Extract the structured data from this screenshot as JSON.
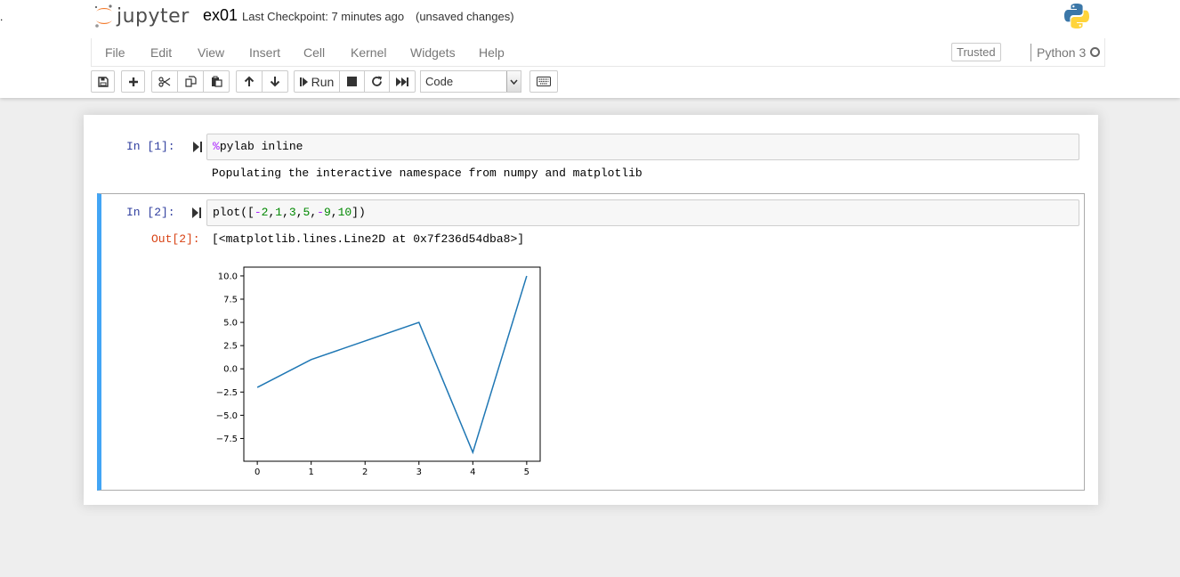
{
  "header": {
    "logo_text": "jupyter",
    "notebook_name": "ex01",
    "checkpoint": "Last Checkpoint: 7 minutes ago",
    "autosave": "(unsaved changes)"
  },
  "menubar": {
    "items": [
      "File",
      "Edit",
      "View",
      "Insert",
      "Cell",
      "Kernel",
      "Widgets",
      "Help"
    ],
    "trusted": "Trusted",
    "kernel": "Python 3"
  },
  "toolbar": {
    "run_label": "Run",
    "cell_type": "Code",
    "icons": [
      "save-icon",
      "plus-icon",
      "cut-icon",
      "copy-icon",
      "paste-icon",
      "arrow-up-icon",
      "arrow-down-icon",
      "step-forward-icon",
      "stop-icon",
      "refresh-icon",
      "fast-forward-icon",
      "keyboard-icon"
    ]
  },
  "cells": [
    {
      "prompt": "In [1]:",
      "code_parts": [
        {
          "text": "%",
          "cls": "cm-magic"
        },
        {
          "text": "pylab inline",
          "cls": ""
        }
      ],
      "output": "Populating the interactive namespace from numpy and matplotlib"
    },
    {
      "prompt": "In [2]:",
      "code_parts": [
        {
          "text": "plot([",
          "cls": ""
        },
        {
          "text": "-",
          "cls": "cm-op"
        },
        {
          "text": "2",
          "cls": "cm-num"
        },
        {
          "text": ",",
          "cls": ""
        },
        {
          "text": "1",
          "cls": "cm-num"
        },
        {
          "text": ",",
          "cls": ""
        },
        {
          "text": "3",
          "cls": "cm-num"
        },
        {
          "text": ",",
          "cls": ""
        },
        {
          "text": "5",
          "cls": "cm-num"
        },
        {
          "text": ",",
          "cls": ""
        },
        {
          "text": "-",
          "cls": "cm-op"
        },
        {
          "text": "9",
          "cls": "cm-num"
        },
        {
          "text": ",",
          "cls": ""
        },
        {
          "text": "10",
          "cls": "cm-num"
        },
        {
          "text": "])",
          "cls": ""
        }
      ],
      "out_prompt": "Out[2]:",
      "output": "[<matplotlib.lines.Line2D at 0x7f236d54dba8>]"
    }
  ],
  "chart_data": {
    "type": "line",
    "x": [
      0,
      1,
      2,
      3,
      4,
      5
    ],
    "series": [
      {
        "values": [
          -2,
          1,
          3,
          5,
          -9,
          10
        ],
        "color": "#1f77b4"
      }
    ],
    "xticks": [
      "0",
      "1",
      "2",
      "3",
      "4",
      "5"
    ],
    "yticks": [
      "10.0",
      "7.5",
      "5.0",
      "2.5",
      "0.0",
      "−2.5",
      "−5.0",
      "−7.5"
    ],
    "ytick_values": [
      10,
      7.5,
      5,
      2.5,
      0,
      -2.5,
      -5,
      -7.5
    ],
    "xlim": [
      -0.25,
      5.25
    ],
    "ylim": [
      -9.95,
      10.95
    ],
    "grid": false
  }
}
